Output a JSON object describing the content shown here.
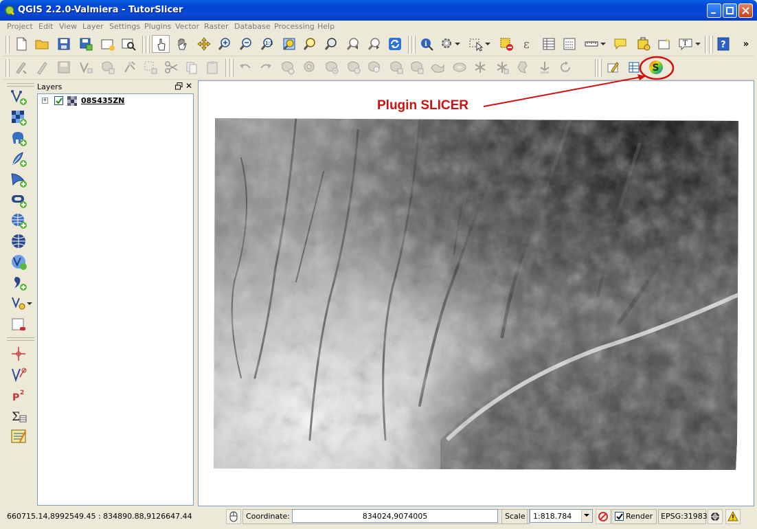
{
  "window": {
    "title": "QGIS 2.2.0-Valmiera - TutorSlicer",
    "icons": {
      "app": "qgis-icon",
      "minimize": "minimize-icon",
      "maximize": "maximize-icon",
      "close": "close-icon"
    }
  },
  "menubar": {
    "items": [
      "Project",
      "Edit",
      "View",
      "Layer",
      "Settings",
      "Plugins",
      "Vector",
      "Raster",
      "Database",
      "Processing",
      "Help"
    ]
  },
  "layers_panel": {
    "title": "Layers",
    "float_icon": "float-icon",
    "close_glyph": "✕",
    "expander_glyph": "+",
    "layers": [
      {
        "name": "08S435ZN",
        "checked": true,
        "type_icon": "raster-layer-icon"
      }
    ]
  },
  "map": {
    "annotation": "Plugin SLICER",
    "annotation_color": "#d01010",
    "layer": "DEM grayscale raster"
  },
  "statusbar": {
    "extent": "660715.14,8992549.45 : 834890.88,9126647.44",
    "coordinate_label": "Coordinate:",
    "coordinate_value": "834024,9074005",
    "scale_label": "Scale",
    "scale_value": "1:818.784",
    "render_label": "Render",
    "render_checked": true,
    "crs": "EPSG:31983"
  },
  "toolbars": {
    "overflow": "»",
    "help": "?",
    "text_tool": "T"
  }
}
